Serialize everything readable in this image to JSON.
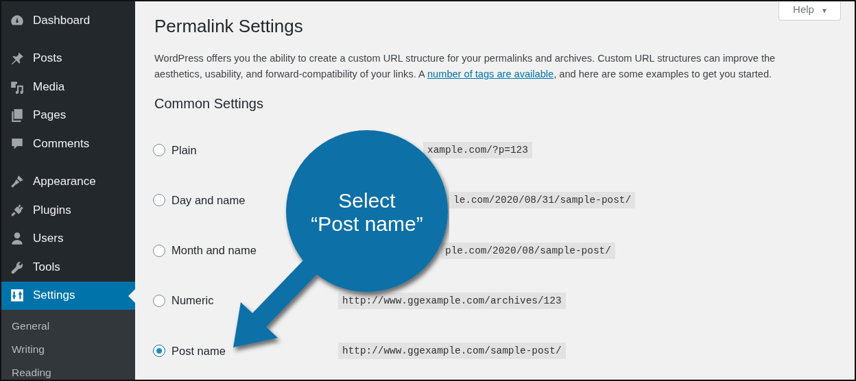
{
  "sidebar": {
    "groups": [
      [
        {
          "label": "Dashboard",
          "selected": false
        }
      ],
      [
        {
          "label": "Posts",
          "selected": false
        },
        {
          "label": "Media",
          "selected": false
        },
        {
          "label": "Pages",
          "selected": false
        },
        {
          "label": "Comments",
          "selected": false
        }
      ],
      [
        {
          "label": "Appearance",
          "selected": false
        },
        {
          "label": "Plugins",
          "selected": false
        },
        {
          "label": "Users",
          "selected": false
        },
        {
          "label": "Tools",
          "selected": false
        },
        {
          "label": "Settings",
          "selected": true
        }
      ]
    ],
    "submenu": [
      "General",
      "Writing",
      "Reading"
    ]
  },
  "help_button": {
    "label": "Help",
    "caret": "▼"
  },
  "title": "Permalink Settings",
  "description": {
    "text_before": "WordPress offers you the ability to create a custom URL structure for your permalinks and archives. Custom URL structures can improve the aesthetics, usability, and forward-compatibility of your links. A ",
    "link": "number of tags are available",
    "text_after": ", and here are some examples to get you started."
  },
  "section_title": "Common Settings",
  "options": [
    {
      "label": "Plain",
      "example": "xample.com/?p=123",
      "selected": false
    },
    {
      "label": "Day and name",
      "example": "le.com/2020/08/31/sample-post/",
      "selected": false
    },
    {
      "label": "Month and name",
      "example": "ple.com/2020/08/sample-post/",
      "selected": false
    },
    {
      "label": "Numeric",
      "example": "http://www.ggexample.com/archives/123",
      "selected": false
    },
    {
      "label": "Post name",
      "example": "http://www.ggexample.com/sample-post/",
      "selected": true
    }
  ],
  "callout": {
    "lines": [
      "Select",
      "“Post name”"
    ]
  }
}
